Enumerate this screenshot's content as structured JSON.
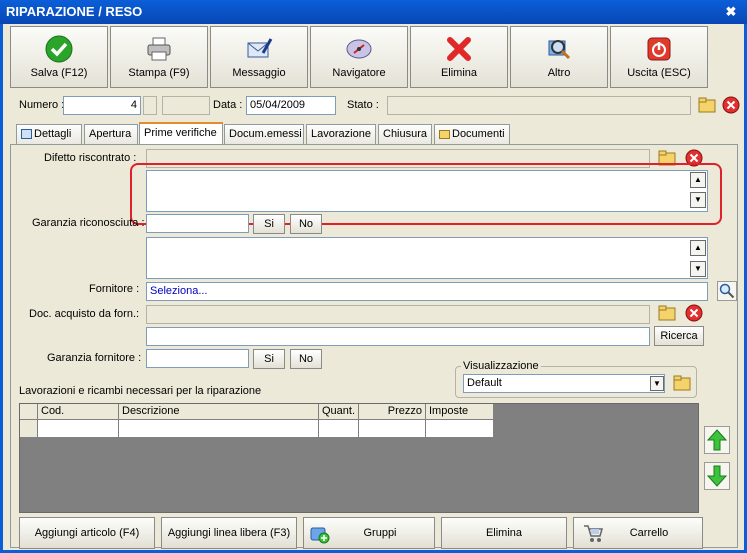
{
  "window": {
    "title": "RIPARAZIONE / RESO",
    "close": "✖"
  },
  "toolbar": [
    {
      "label": "Salva (F12)"
    },
    {
      "label": "Stampa (F9)"
    },
    {
      "label": "Messaggio"
    },
    {
      "label": "Navigatore"
    },
    {
      "label": "Elimina"
    },
    {
      "label": "Altro"
    },
    {
      "label": "Uscita (ESC)"
    }
  ],
  "header": {
    "numero_label": "Numero :",
    "numero_value": "4",
    "data_label": "Data :",
    "data_value": "05/04/2009",
    "stato_label": "Stato :",
    "stato_value": ""
  },
  "tabs": [
    "Dettagli",
    "Apertura",
    "Prime verifiche",
    "Docum.emessi",
    "Lavorazione",
    "Chiusura",
    "Documenti"
  ],
  "active_tab": "Prime verifiche",
  "form": {
    "difetto_label": "Difetto riscontrato :",
    "garanzia_label": "Garanzia riconosciuta :",
    "garanzia_si": "Si",
    "garanzia_no": "No",
    "fornitore_label": "Fornitore :",
    "fornitore_value": "Seleziona...",
    "doc_acquisto_label": "Doc. acquisto da forn.:",
    "ricerca": "Ricerca",
    "garanzia_fornitore_label": "Garanzia fornitore :",
    "gf_si": "Si",
    "gf_no": "No",
    "visualizzazione_label": "Visualizzazione",
    "visualizzazione_value": "Default",
    "lavorazioni_label": "Lavorazioni e ricambi necessari per la riparazione"
  },
  "grid": {
    "columns": [
      "",
      "Cod.",
      "Descrizione",
      "Quant.",
      "Prezzo",
      "Imposte"
    ],
    "rows": [
      [
        "",
        "",
        "",
        "",
        "",
        ""
      ]
    ]
  },
  "bottom": {
    "aggiungi_articolo": "Aggiungi articolo (F4)",
    "aggiungi_linea": "Aggiungi linea libera (F3)",
    "gruppi": "Gruppi",
    "elimina": "Elimina",
    "carrello": "Carrello"
  },
  "colors": {
    "title_bar": "#0a5fd8",
    "highlight": "#e0202a",
    "fornitore_text": "#0000c0"
  }
}
